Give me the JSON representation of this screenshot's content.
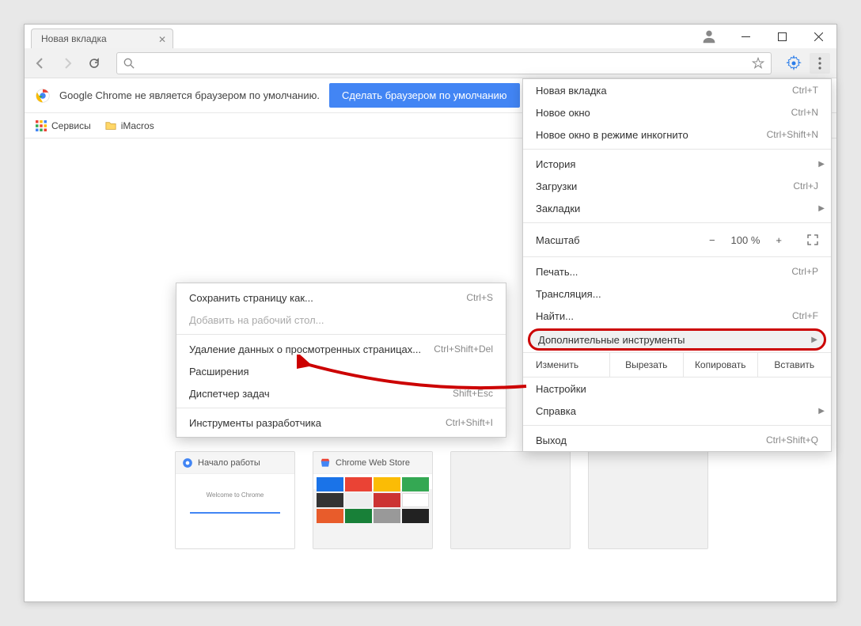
{
  "tab": {
    "title": "Новая вкладка"
  },
  "infobar": {
    "text": "Google Chrome не является браузером по умолчанию.",
    "button": "Сделать браузером по умолчанию"
  },
  "bookmarks": {
    "apps": "Сервисы",
    "item1": "iMacros"
  },
  "thumbs": [
    {
      "title": "Начало работы"
    },
    {
      "title": "Chrome Web Store"
    },
    {
      "title": ""
    },
    {
      "title": ""
    }
  ],
  "menu": {
    "new_tab": "Новая вкладка",
    "new_tab_sc": "Ctrl+T",
    "new_window": "Новое окно",
    "new_window_sc": "Ctrl+N",
    "incognito": "Новое окно в режиме инкогнито",
    "incognito_sc": "Ctrl+Shift+N",
    "history": "История",
    "downloads": "Загрузки",
    "downloads_sc": "Ctrl+J",
    "bookmarks": "Закладки",
    "zoom": "Масштаб",
    "zoom_val": "100 %",
    "print": "Печать...",
    "print_sc": "Ctrl+P",
    "cast": "Трансляция...",
    "find": "Найти...",
    "find_sc": "Ctrl+F",
    "more_tools": "Дополнительные инструменты",
    "edit": "Изменить",
    "cut": "Вырезать",
    "copy": "Копировать",
    "paste": "Вставить",
    "settings": "Настройки",
    "help": "Справка",
    "exit": "Выход",
    "exit_sc": "Ctrl+Shift+Q"
  },
  "submenu": {
    "save_as": "Сохранить страницу как...",
    "save_as_sc": "Ctrl+S",
    "add_desktop": "Добавить на рабочий стол...",
    "clear_data": "Удаление данных о просмотренных страницах...",
    "clear_data_sc": "Ctrl+Shift+Del",
    "extensions": "Расширения",
    "task_mgr": "Диспетчер задач",
    "task_mgr_sc": "Shift+Esc",
    "devtools": "Инструменты разработчика",
    "devtools_sc": "Ctrl+Shift+I"
  }
}
